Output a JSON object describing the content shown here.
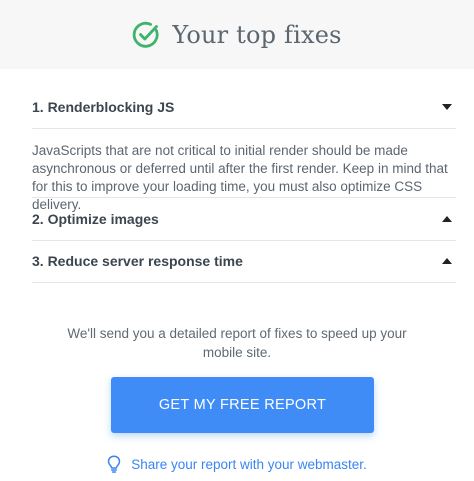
{
  "header": {
    "title": "Your top fixes",
    "icon": "check-circle-icon"
  },
  "fixes": [
    {
      "label": "1. Renderblocking JS",
      "expanded": true,
      "toggle_icon": "caret-down-icon",
      "body": "JavaScripts that are not critical to initial render should be made asynchronous or deferred until after the first render. Keep in mind that for this to improve your loading time, you must also optimize CSS delivery."
    },
    {
      "label": "2. Optimize images",
      "expanded": false,
      "toggle_icon": "caret-up-icon"
    },
    {
      "label": "3. Reduce server response time",
      "expanded": false,
      "toggle_icon": "caret-up-icon"
    }
  ],
  "note": "We'll send you a detailed report of fixes to speed up your mobile site.",
  "cta": {
    "label": "GET MY FREE REPORT"
  },
  "share": {
    "icon": "lightbulb-icon",
    "label": "Share your report with your webmaster."
  },
  "colors": {
    "accent_green": "#3fb36b",
    "button_blue": "#3f8cf6",
    "link_blue": "#3a86f0",
    "header_bg": "#f7f7f7"
  }
}
